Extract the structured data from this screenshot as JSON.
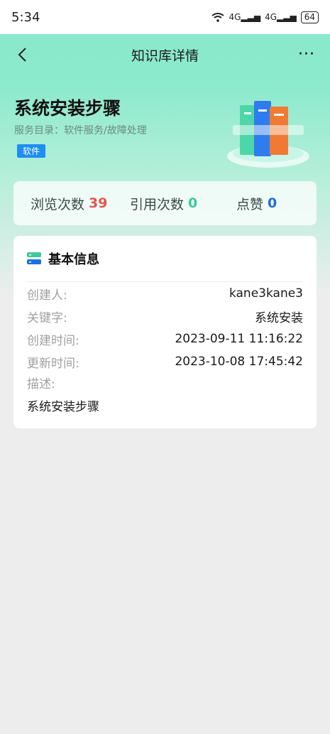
{
  "status": {
    "time": "5:34",
    "battery": "64",
    "network": "4G"
  },
  "nav": {
    "title": "知识库详情",
    "more": "···"
  },
  "kb": {
    "title": "系统安装步骤",
    "catalog": "服务目录：软件服务/故障处理",
    "tag": "软件"
  },
  "stats": {
    "views_label": "浏览次数",
    "views": "39",
    "cites_label": "引用次数",
    "cites": "0",
    "likes_label": "点赞",
    "likes": "0"
  },
  "info": {
    "heading": "基本信息",
    "creator_label": "创建人:",
    "creator": "kane3kane3",
    "keyword_label": "关键字:",
    "keyword": "系统安装",
    "created_label": "创建时间:",
    "created": "2023-09-11 11:16:22",
    "updated_label": "更新时间:",
    "updated": "2023-10-08 17:45:42",
    "desc_label": "描述:",
    "desc": "系统安装步骤"
  },
  "colors": {
    "header_green": "#86e8c8",
    "tag_blue": "#1f8ef1",
    "views_red": "#e5564f",
    "cites_green": "#3dc99c",
    "likes_blue": "#1f6ee0"
  }
}
